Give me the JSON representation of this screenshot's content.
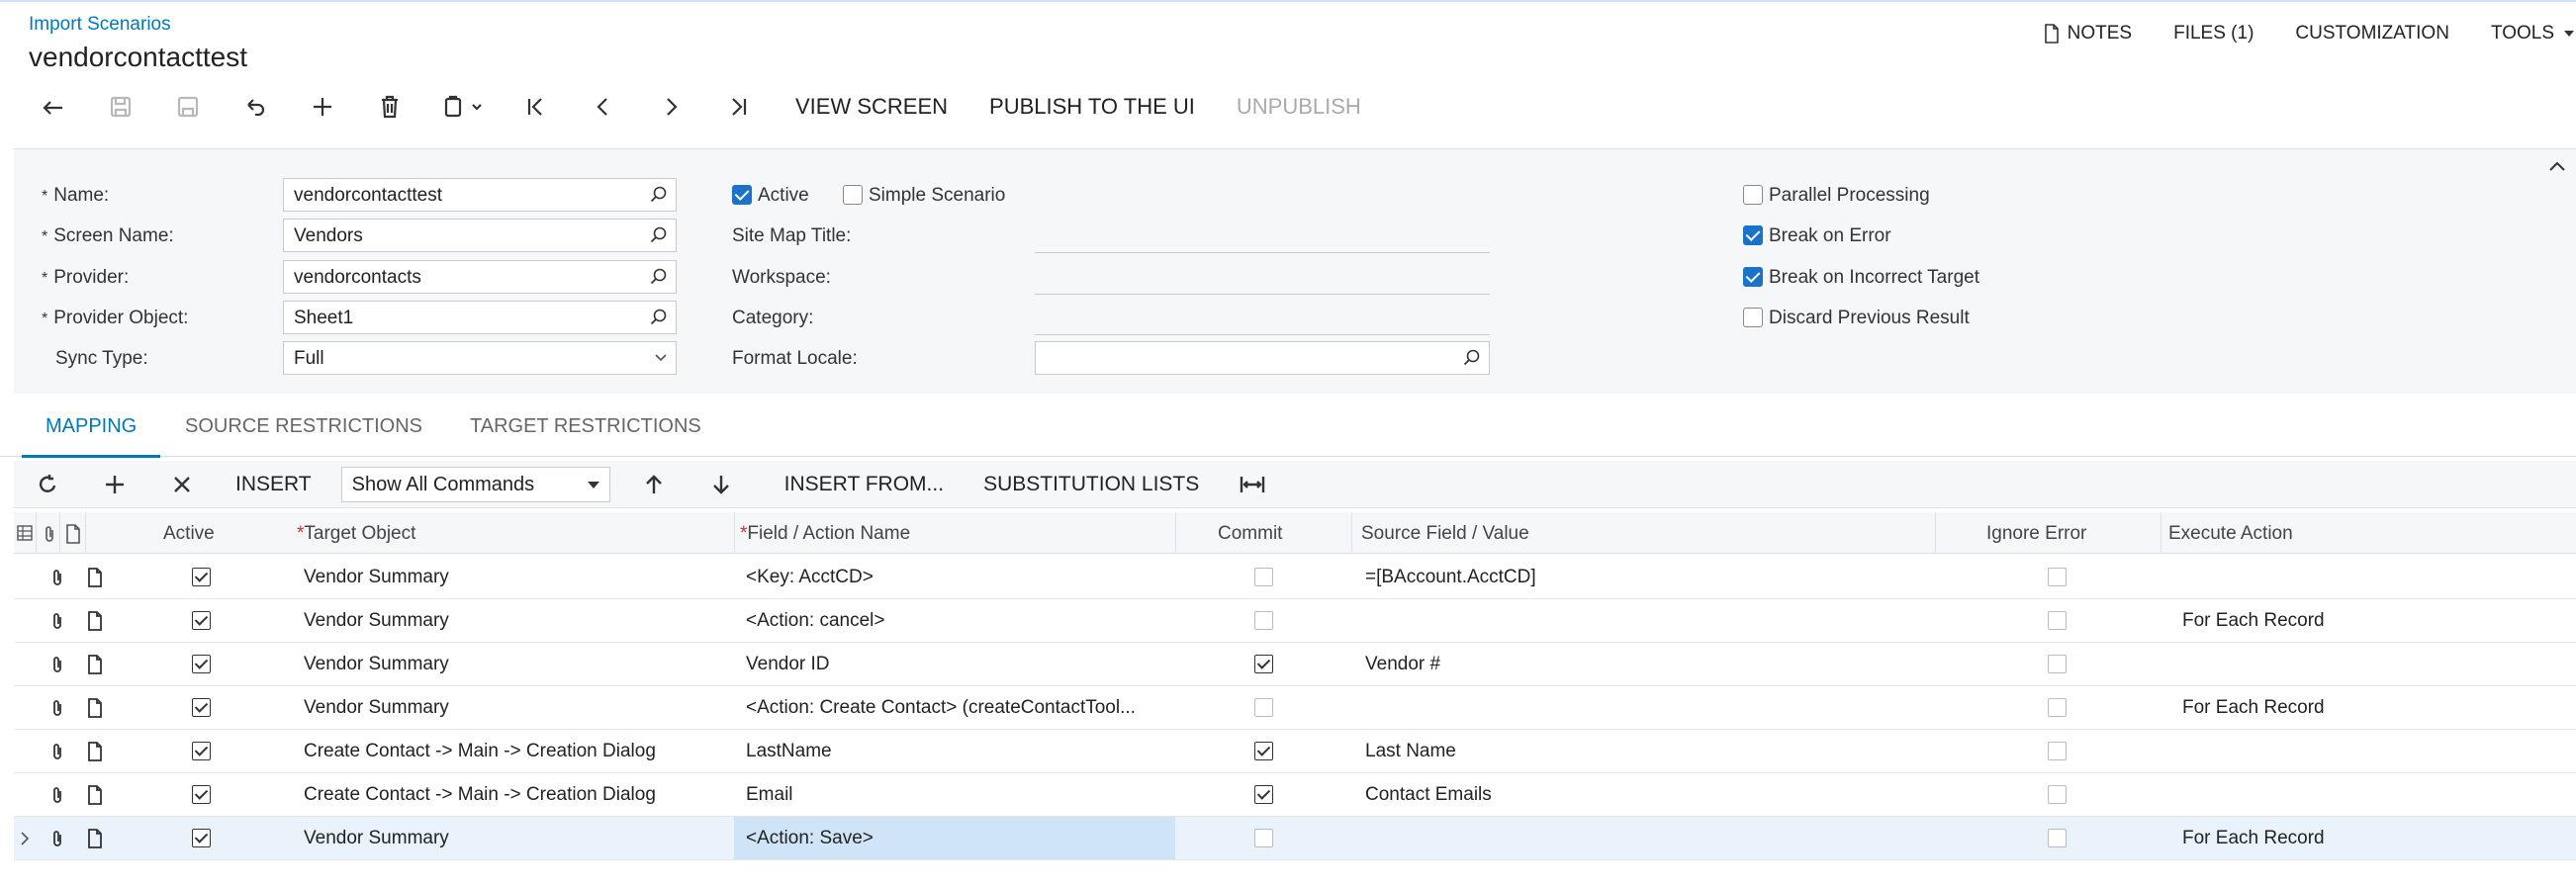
{
  "header": {
    "breadcrumb": "Import Scenarios",
    "title": "vendorcontacttest",
    "links": {
      "notes": "NOTES",
      "files": "FILES (1)",
      "customization": "CUSTOMIZATION",
      "tools": "TOOLS"
    }
  },
  "toolbar": {
    "view_screen": "VIEW SCREEN",
    "publish": "PUBLISH TO THE UI",
    "unpublish": "UNPUBLISH"
  },
  "form": {
    "name_label": "Name:",
    "name_value": "vendorcontacttest",
    "screen_label": "Screen Name:",
    "screen_value": "Vendors",
    "provider_label": "Provider:",
    "provider_value": "vendorcontacts",
    "provider_object_label": "Provider Object:",
    "provider_object_value": "Sheet1",
    "sync_label": "Sync Type:",
    "sync_value": "Full",
    "active_label": "Active",
    "simple_label": "Simple Scenario",
    "sitemap_label": "Site Map Title:",
    "workspace_label": "Workspace:",
    "category_label": "Category:",
    "locale_label": "Format Locale:",
    "parallel_label": "Parallel Processing",
    "break_error_label": "Break on Error",
    "break_target_label": "Break on Incorrect Target",
    "discard_label": "Discard Previous Result"
  },
  "tabs": {
    "mapping": "MAPPING",
    "source": "SOURCE RESTRICTIONS",
    "target": "TARGET RESTRICTIONS"
  },
  "grid_toolbar": {
    "insert": "INSERT",
    "commands_select": "Show All Commands",
    "insert_from": "INSERT FROM...",
    "substitution": "SUBSTITUTION LISTS"
  },
  "columns": {
    "active": "Active",
    "target": "Target Object",
    "field": "Field / Action Name",
    "commit": "Commit",
    "source": "Source Field / Value",
    "ignore": "Ignore Error",
    "execute": "Execute Action"
  },
  "rows": [
    {
      "target": "Vendor Summary",
      "field": "<Key: AcctCD>",
      "source": "=[BAccount.AcctCD]",
      "execute": ""
    },
    {
      "target": "Vendor Summary",
      "field": "<Action: cancel>",
      "source": "",
      "execute": "For Each Record"
    },
    {
      "target": "Vendor Summary",
      "field": "Vendor ID",
      "source": "Vendor #",
      "execute": ""
    },
    {
      "target": "Vendor Summary",
      "field": "<Action: Create Contact> (createContactTool...",
      "source": "",
      "execute": "For Each Record"
    },
    {
      "target": "Create Contact -> Main -> Creation Dialog",
      "field": "LastName",
      "source": "Last Name",
      "execute": ""
    },
    {
      "target": "Create Contact -> Main -> Creation Dialog",
      "field": "Email",
      "source": "Contact Emails",
      "execute": ""
    },
    {
      "target": "Vendor Summary",
      "field": "<Action: Save>",
      "source": "",
      "execute": "For Each Record"
    }
  ]
}
